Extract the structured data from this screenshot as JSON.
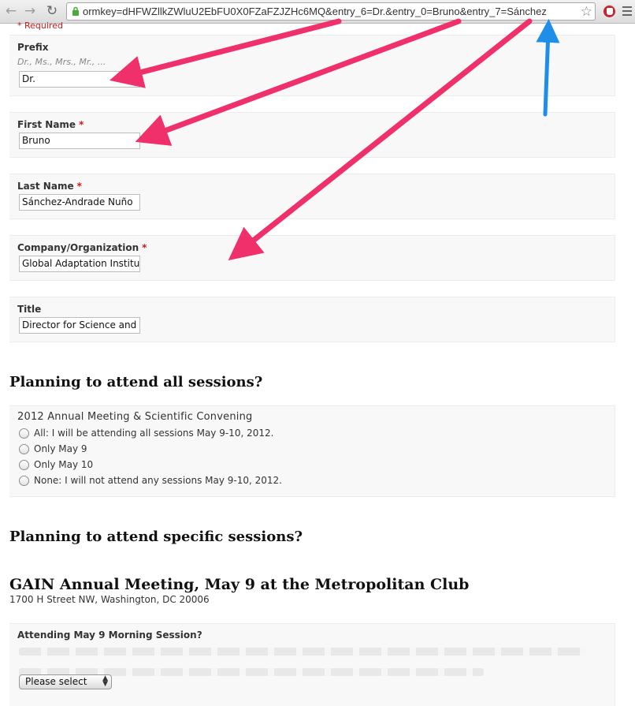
{
  "browser": {
    "url": "ormkey=dHFWZllkZWluU2EbFU0X0FZaFZJZHc6MQ&entry_6=Dr.&entry_0=Bruno&entry_7=Sánchez",
    "back_icon": "back-arrow-icon",
    "forward_icon": "forward-arrow-icon",
    "reload_icon": "reload-icon",
    "star_icon": "bookmark-star-icon"
  },
  "form": {
    "required_note": "* Required",
    "fields": [
      {
        "label": "Prefix",
        "required": false,
        "help": "Dr., Ms., Mrs., Mr., ...",
        "value": "Dr."
      },
      {
        "label": "First Name",
        "required": true,
        "help": "",
        "value": "Bruno"
      },
      {
        "label": "Last Name",
        "required": true,
        "help": "",
        "value": "Sánchez-Andrade Nuño"
      },
      {
        "label": "Company/Organization",
        "required": true,
        "help": "",
        "value": "Global Adaptation Institut"
      },
      {
        "label": "Title",
        "required": false,
        "help": "",
        "value": "Director for Science and T"
      }
    ],
    "required_marker": "*"
  },
  "sessions": {
    "heading": "Planning to attend all sessions?",
    "question": "2012 Annual Meeting & Scientific Convening",
    "options": [
      "All: I will be attending all sessions May 9-10, 2012.",
      "Only May 9",
      "Only May 10",
      "None: I will not attend any sessions May 9-10, 2012."
    ]
  },
  "specific": {
    "heading": "Planning to attend specific sessions?",
    "event_title": "GAIN Annual Meeting, May 9 at the Metropolitan Club",
    "event_address": "1700 H Street NW, Washington, DC  20006",
    "question": "Attending May 9 Morning Session?",
    "select_value": "Please select"
  },
  "colors": {
    "annotation_pink": "#f0306a",
    "annotation_blue": "#1f8ee8",
    "required_red": "#c41b1b"
  }
}
